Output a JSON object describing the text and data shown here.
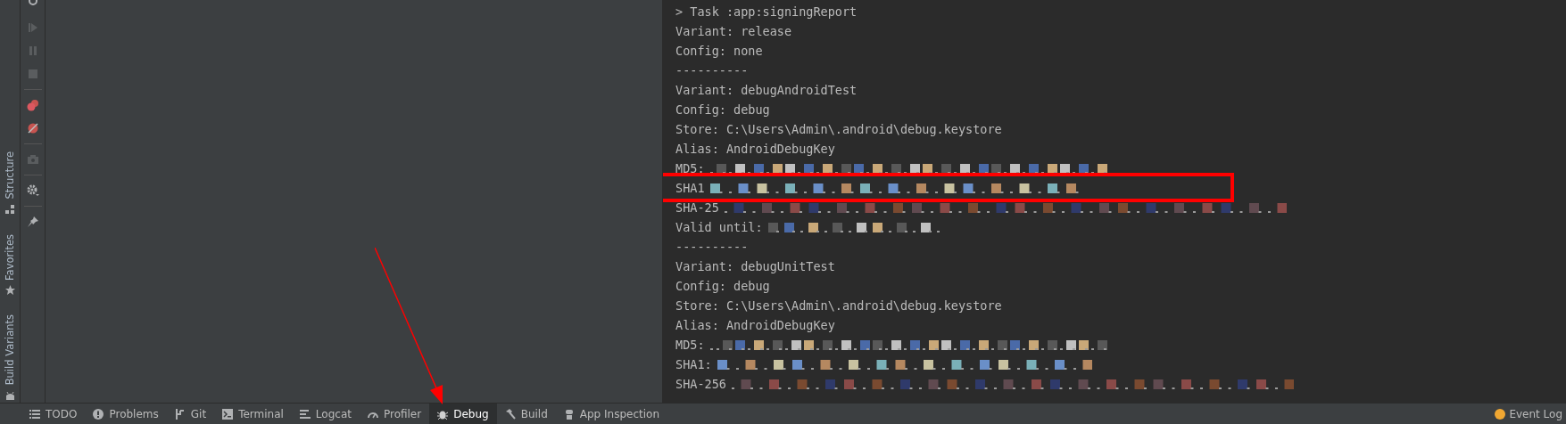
{
  "side_strip": [
    {
      "label": "Structure"
    },
    {
      "label": "Favorites"
    },
    {
      "label": "Build Variants"
    }
  ],
  "console": {
    "lines": [
      {
        "text": "> Task :app:signingReport",
        "kind": "plain",
        "boxed": false
      },
      {
        "text": "Variant: release",
        "kind": "plain",
        "boxed": false
      },
      {
        "text": "Config: none",
        "kind": "plain",
        "boxed": false
      },
      {
        "text": "----------",
        "kind": "plain",
        "boxed": false
      },
      {
        "text": "Variant: debugAndroidTest",
        "kind": "plain",
        "boxed": false
      },
      {
        "text": "Config: debug",
        "kind": "plain",
        "boxed": false
      },
      {
        "text": "Store: C:\\Users\\Admin\\.android\\debug.keystore",
        "kind": "plain",
        "boxed": false
      },
      {
        "text": "Alias: AndroidDebugKey",
        "kind": "plain",
        "boxed": false
      },
      {
        "text": "MD5:",
        "kind": "md5",
        "boxed": false
      },
      {
        "text": "SHA1",
        "kind": "sha1",
        "boxed": true
      },
      {
        "text": "SHA-25",
        "kind": "sha256",
        "boxed": false
      },
      {
        "text": "Valid until:",
        "kind": "date",
        "boxed": false
      },
      {
        "text": "----------",
        "kind": "plain",
        "boxed": false
      },
      {
        "text": "Variant: debugUnitTest",
        "kind": "plain",
        "boxed": false
      },
      {
        "text": "Config: debug",
        "kind": "plain",
        "boxed": false
      },
      {
        "text": "Store: C:\\Users\\Admin\\.android\\debug.keystore",
        "kind": "plain",
        "boxed": false
      },
      {
        "text": "Alias: AndroidDebugKey",
        "kind": "plain",
        "boxed": false
      },
      {
        "text": "MD5:",
        "kind": "md5",
        "boxed": false
      },
      {
        "text": "SHA1:",
        "kind": "sha1",
        "boxed": false
      },
      {
        "text": "SHA-256",
        "kind": "sha256",
        "boxed": false
      }
    ]
  },
  "bottom_tabs": [
    {
      "label": "TODO",
      "selected": false
    },
    {
      "label": "Problems",
      "selected": false
    },
    {
      "label": "Git",
      "selected": false
    },
    {
      "label": "Terminal",
      "selected": false
    },
    {
      "label": "Logcat",
      "selected": false
    },
    {
      "label": "Profiler",
      "selected": false
    },
    {
      "label": "Debug",
      "selected": true
    },
    {
      "label": "Build",
      "selected": false
    },
    {
      "label": "App Inspection",
      "selected": false
    }
  ],
  "event_log": {
    "label": "Event Log"
  },
  "annotations": [
    {
      "kind": "arrow"
    }
  ]
}
